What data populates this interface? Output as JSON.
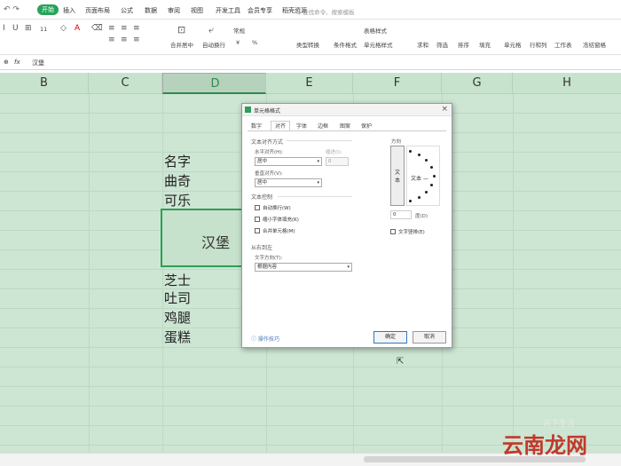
{
  "menu": {
    "quick_access": "↶ ↷",
    "start": "开始",
    "tabs": [
      "插入",
      "页面布局",
      "公式",
      "数据",
      "审阅",
      "视图",
      "开发工具",
      "会员专享",
      "稻壳资源"
    ],
    "search_placeholder": "Q 查找命令、搜索模板"
  },
  "toolbar": {
    "font_size": "11",
    "merge_center": "合并居中",
    "auto_wrap": "自动换行",
    "number_format": "常规",
    "currency": "¥",
    "percent": "%",
    "type_convert": "类型转换",
    "cond_format": "条件格式",
    "table_style": "表格样式",
    "cell_style": "单元格样式",
    "sum": "求和",
    "filter": "筛选",
    "sort": "排序",
    "fill": "填充",
    "cell": "单元格",
    "row_col": "行和列",
    "worksheet": "工作表",
    "freeze": "冻结窗格"
  },
  "formula_bar": {
    "zoom_icon": "⊕",
    "fx": "fx",
    "content": "汉堡"
  },
  "columns": [
    "B",
    "C",
    "D",
    "E",
    "F",
    "G",
    "H"
  ],
  "cells": {
    "r1": "名字",
    "r2": "曲奇",
    "r3": "可乐",
    "merged": "汉堡",
    "r5": "芝士",
    "r6": "吐司",
    "r7": "鸡腿",
    "r8": "蛋糕"
  },
  "dialog": {
    "title": "单元格格式",
    "close": "×",
    "tabs": [
      "数字",
      "对齐",
      "字体",
      "边框",
      "图案",
      "保护"
    ],
    "active_tab": "对齐",
    "text_align_section": "文本对齐方式",
    "h_align_label": "水平对齐(H):",
    "h_align_value": "居中",
    "indent_label": "缩进(I):",
    "indent_value": "0",
    "v_align_label": "垂直对齐(V):",
    "v_align_value": "居中",
    "text_control_section": "文本控制",
    "wrap_text": "自动换行(W)",
    "shrink_fit": "缩小字体填充(K)",
    "merge_cells": "合并单元格(M)",
    "rtl_section": "从右到左",
    "text_direction_label": "文字方向(T):",
    "text_direction_value": "根据内容",
    "orientation_label": "方向",
    "vertical_text": "文本",
    "horizontal_text": "文本 —",
    "degree_value": "0",
    "degree_label": "度(D)",
    "vertical_text_checkbox": "文字竖排(E)",
    "help_link": "操作技巧",
    "ok": "确定",
    "cancel": "取消"
  },
  "watermark": "云南龙网",
  "watermark2": "天下生活",
  "colors": {
    "accent": "#2c9f56",
    "grid": "#cde5d3"
  }
}
